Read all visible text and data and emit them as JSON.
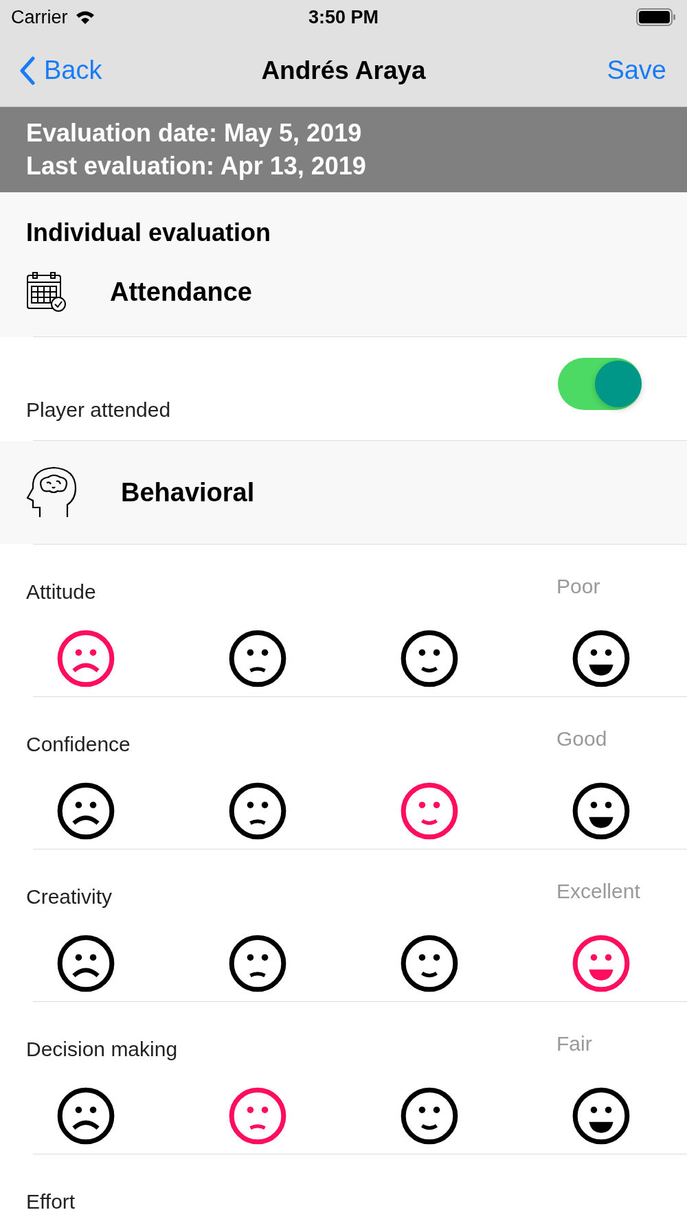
{
  "status_bar": {
    "carrier": "Carrier",
    "time": "3:50 PM"
  },
  "nav": {
    "back": "Back",
    "title": "Andrés Araya",
    "action": "Save"
  },
  "banner": {
    "lines": [
      "Evaluation date: May 5, 2019",
      "Last evaluation: Apr 13, 2019"
    ]
  },
  "section_title": "Individual evaluation",
  "attendance": {
    "title": "Attendance",
    "label": "Player attended",
    "on": true
  },
  "behavioral": {
    "title": "Behavioral",
    "items": [
      {
        "label": "Attitude",
        "rating": "Poor",
        "faces": [
          {
            "selected": true
          },
          {
            "selected": false
          },
          {
            "selected": false
          },
          {
            "selected": false
          }
        ]
      },
      {
        "label": "Confidence",
        "rating": "Good",
        "faces": [
          {
            "selected": false
          },
          {
            "selected": false
          },
          {
            "selected": true
          },
          {
            "selected": false
          }
        ]
      },
      {
        "label": "Creativity",
        "rating": "Excellent",
        "faces": [
          {
            "selected": false
          },
          {
            "selected": false
          },
          {
            "selected": false
          },
          {
            "selected": true
          }
        ]
      },
      {
        "label": "Decision making",
        "rating": "Fair",
        "faces": [
          {
            "selected": false
          },
          {
            "selected": true
          },
          {
            "selected": false
          },
          {
            "selected": false
          }
        ]
      },
      {
        "label": "Effort"
      }
    ]
  }
}
